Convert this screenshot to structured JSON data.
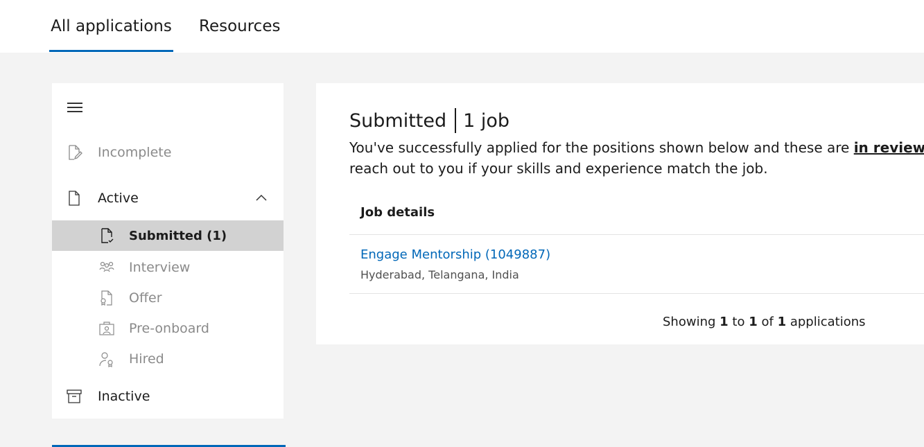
{
  "tabs": [
    {
      "label": "All applications",
      "active": true
    },
    {
      "label": "Resources",
      "active": false
    }
  ],
  "sidebar": {
    "items": [
      {
        "label": "Incomplete",
        "icon": "edit-document-icon"
      },
      {
        "label": "Active",
        "icon": "document-icon",
        "expanded": true
      },
      {
        "label": "Submitted (1)",
        "icon": "document-check-icon",
        "selected": true
      },
      {
        "label": "Interview",
        "icon": "people-icon"
      },
      {
        "label": "Offer",
        "icon": "document-badge-icon"
      },
      {
        "label": "Pre-onboard",
        "icon": "onboard-icon"
      },
      {
        "label": "Hired",
        "icon": "person-badge-icon"
      },
      {
        "label": "Inactive",
        "icon": "archive-icon"
      }
    ]
  },
  "main": {
    "heading_status": "Submitted",
    "heading_count": "1 job",
    "description_before": "You've successfully applied for the positions shown below and these are ",
    "description_link": "in review",
    "description_after": ". We'll reach out to you if your skills and experience match the job.",
    "table_header": "Job details",
    "jobs": [
      {
        "title": "Engage Mentorship (1049887)",
        "location": "Hyderabad, Telangana, India"
      }
    ],
    "pagination": {
      "prefix": "Showing",
      "from": "1",
      "to_word": "to",
      "to": "1",
      "of_word": "of",
      "total": "1",
      "suffix": "applications"
    }
  },
  "colors": {
    "accent": "#0067b8",
    "selected_bg": "#d2d2d2",
    "page_bg": "#f3f3f3"
  }
}
